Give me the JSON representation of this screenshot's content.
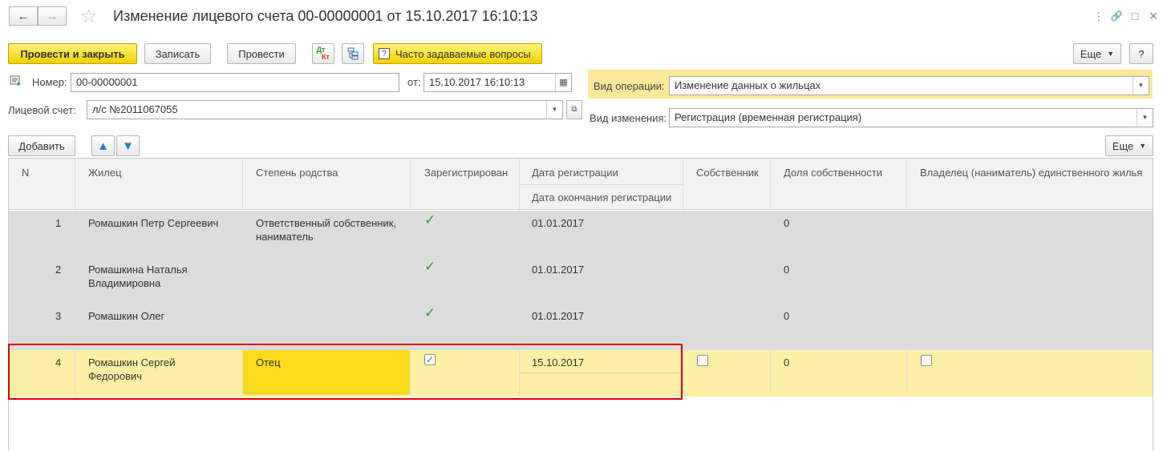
{
  "window": {
    "title": "Изменение лицевого счета 00-00000001 от 15.10.2017 16:10:13",
    "back_icon": "←",
    "forward_icon": "→",
    "star_icon": "☆",
    "menu_icon": "⋮",
    "link_icon": "🔗",
    "maximize_icon": "□",
    "close_icon": "×"
  },
  "toolbar": {
    "post_close": "Провести и закрыть",
    "write": "Записать",
    "post": "Провести",
    "dt_top": "Дт",
    "dt_bottom": "Кт",
    "faq_label": "Часто задаваемые вопросы",
    "faq_icon": "?",
    "more": "Еще",
    "help": "?"
  },
  "form": {
    "number_label": "Номер:",
    "number_value": "00-00000001",
    "date_label": "от:",
    "date_value": "15.10.2017 16:10:13",
    "account_label": "Лицевой счет:",
    "account_value": "л/с №2011067055",
    "operation_label": "Вид операции:",
    "operation_value": "Изменение данных о жильцах",
    "change_label": "Вид изменения:",
    "change_value": "Регистрация (временная регистрация)"
  },
  "table_toolbar": {
    "add": "Добавить",
    "up_icon": "🡅",
    "down_icon": "🡇",
    "more": "Еще"
  },
  "columns": {
    "n": "N",
    "resident": "Жилец",
    "relation": "Степень родства",
    "registered": "Зарегистрирован",
    "reg_date": "Дата регистрации",
    "reg_end_date": "Дата окончания регистрации",
    "owner": "Собственник",
    "share": "Доля собственности",
    "sole_owner": "Владелец (наниматель) единственного жилья"
  },
  "rows": [
    {
      "n": "1",
      "resident": "Ромашкин Петр Сергеевич",
      "relation": "Ответственный собственник, наниматель",
      "registered": true,
      "reg_date": "01.01.2017",
      "share": "0"
    },
    {
      "n": "2",
      "resident": "Ромашкина Наталья Владимировна",
      "relation": "",
      "registered": true,
      "reg_date": "01.01.2017",
      "share": "0"
    },
    {
      "n": "3",
      "resident": "Ромашкин Олег",
      "relation": "",
      "registered": true,
      "reg_date": "01.01.2017",
      "share": "0"
    },
    {
      "n": "4",
      "resident": "Ромашкин Сергей Федорович",
      "relation": "Отец",
      "registered": true,
      "reg_date": "15.10.2017",
      "share": "0"
    }
  ],
  "colors": {
    "accent_yellow": "#f1d200",
    "selected_row": "#fdf0a6",
    "highlight_red": "#e00000",
    "check_green": "#2a9d34"
  }
}
